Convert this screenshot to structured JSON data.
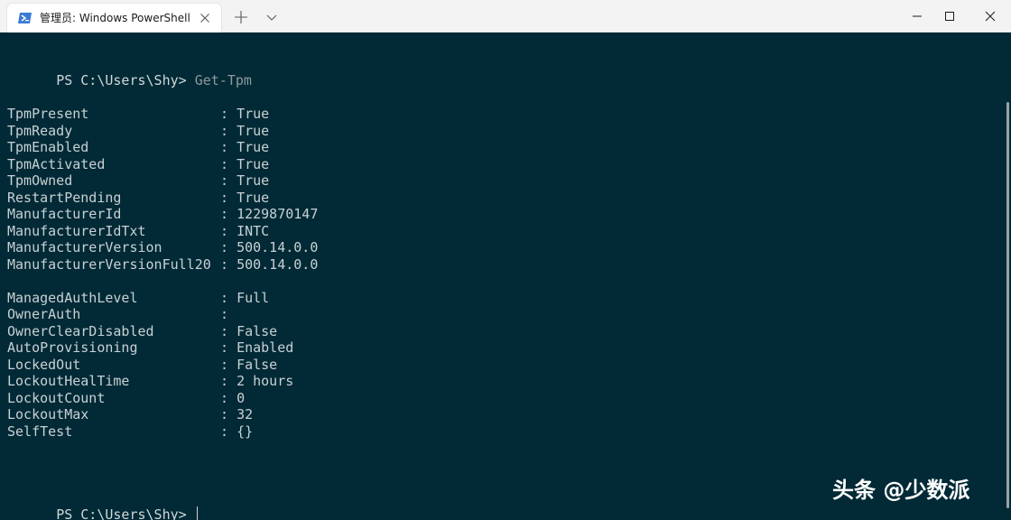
{
  "window": {
    "tab_title": "管理员: Windows PowerShell",
    "tab_icon": "powershell-icon",
    "accent_color": "#3a7bd5"
  },
  "terminal": {
    "background": "#012a36",
    "prompt_1": "PS C:\\Users\\Shy>",
    "command_1": "Get-Tpm",
    "output": [
      {
        "key": "TpmPresent",
        "value": "True"
      },
      {
        "key": "TpmReady",
        "value": "True"
      },
      {
        "key": "TpmEnabled",
        "value": "True"
      },
      {
        "key": "TpmActivated",
        "value": "True"
      },
      {
        "key": "TpmOwned",
        "value": "True"
      },
      {
        "key": "RestartPending",
        "value": "True"
      },
      {
        "key": "ManufacturerId",
        "value": "1229870147"
      },
      {
        "key": "ManufacturerIdTxt",
        "value": "INTC"
      },
      {
        "key": "ManufacturerVersion",
        "value": "500.14.0.0"
      },
      {
        "key": "ManufacturerVersionFull20",
        "value": "500.14.0.0"
      },
      {
        "key": "ManagedAuthLevel",
        "value": "Full"
      },
      {
        "key": "OwnerAuth",
        "value": ""
      },
      {
        "key": "OwnerClearDisabled",
        "value": "False"
      },
      {
        "key": "AutoProvisioning",
        "value": "Enabled"
      },
      {
        "key": "LockedOut",
        "value": "False"
      },
      {
        "key": "LockoutHealTime",
        "value": "2 hours"
      },
      {
        "key": "LockoutCount",
        "value": "0"
      },
      {
        "key": "LockoutMax",
        "value": "32"
      },
      {
        "key": "SelfTest",
        "value": "{}"
      }
    ],
    "prompt_2": "PS C:\\Users\\Shy>"
  },
  "watermark": "头条 @少数派"
}
